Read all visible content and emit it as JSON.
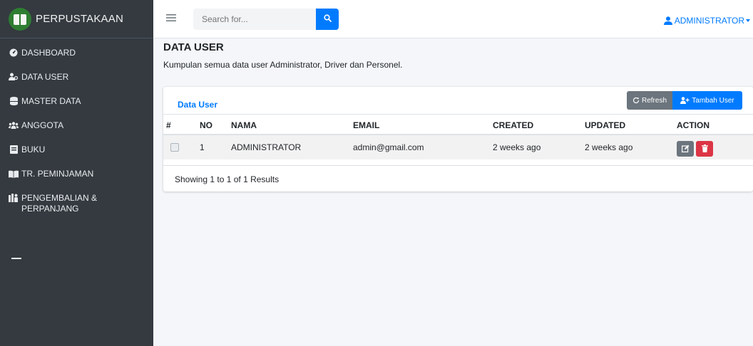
{
  "brand": {
    "name": "PERPUSTAKAAN"
  },
  "sidebar": {
    "items": [
      {
        "label": "DASHBOARD",
        "icon": "tachometer-icon"
      },
      {
        "label": "DATA USER",
        "icon": "users-icon"
      },
      {
        "label": "MASTER DATA",
        "icon": "database-icon"
      },
      {
        "label": "ANGGOTA",
        "icon": "members-icon"
      },
      {
        "label": "BUKU",
        "icon": "book-icon"
      },
      {
        "label": "TR. PEMINJAMAN",
        "icon": "open-book-icon"
      },
      {
        "label": "PENGEMBALIAN & PERPANJANG",
        "icon": "return-icon"
      }
    ]
  },
  "topbar": {
    "search_placeholder": "Search for...",
    "user_label": "ADMINISTRATOR"
  },
  "page": {
    "title": "DATA USER",
    "description": "Kumpulan semua data user Administrator, Driver dan Personel."
  },
  "card": {
    "title": "Data User",
    "refresh_label": "Refresh",
    "add_label": "Tambah User"
  },
  "table": {
    "columns": [
      "#",
      "NO",
      "NAMA",
      "EMAIL",
      "CREATED",
      "UPDATED",
      "ACTION"
    ],
    "rows": [
      {
        "no": "1",
        "nama": "ADMINISTRATOR",
        "email": "admin@gmail.com",
        "created": "2 weeks ago",
        "updated": "2 weeks ago"
      }
    ],
    "footer": "Showing 1 to 1 of 1 Results"
  },
  "colors": {
    "sidebar": "#343a40",
    "primary": "#007bff",
    "secondary": "#6c757d",
    "danger": "#dc3545"
  }
}
